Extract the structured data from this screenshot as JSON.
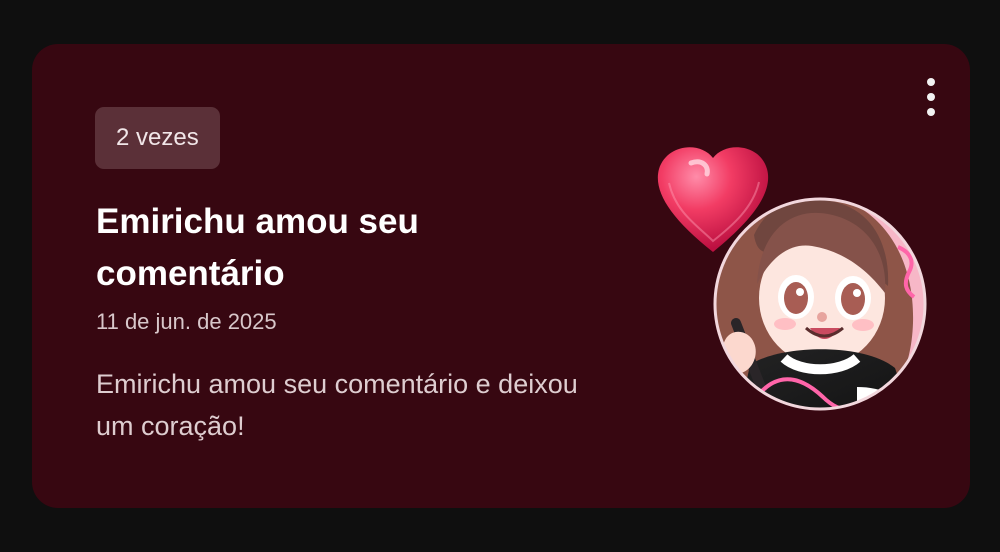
{
  "notification": {
    "count_badge": "2 vezes",
    "title": "Emirichu amou seu comentário",
    "date": "11 de jun. de 2025",
    "message": "Emirichu amou seu comentário e deixou um coração!"
  },
  "colors": {
    "background": "#0f0f0f",
    "card": "#370711",
    "badge": "#5b3038",
    "heart": "#ea2e57"
  },
  "icons": {
    "menu": "more-vert-icon",
    "heart": "heart-icon"
  }
}
